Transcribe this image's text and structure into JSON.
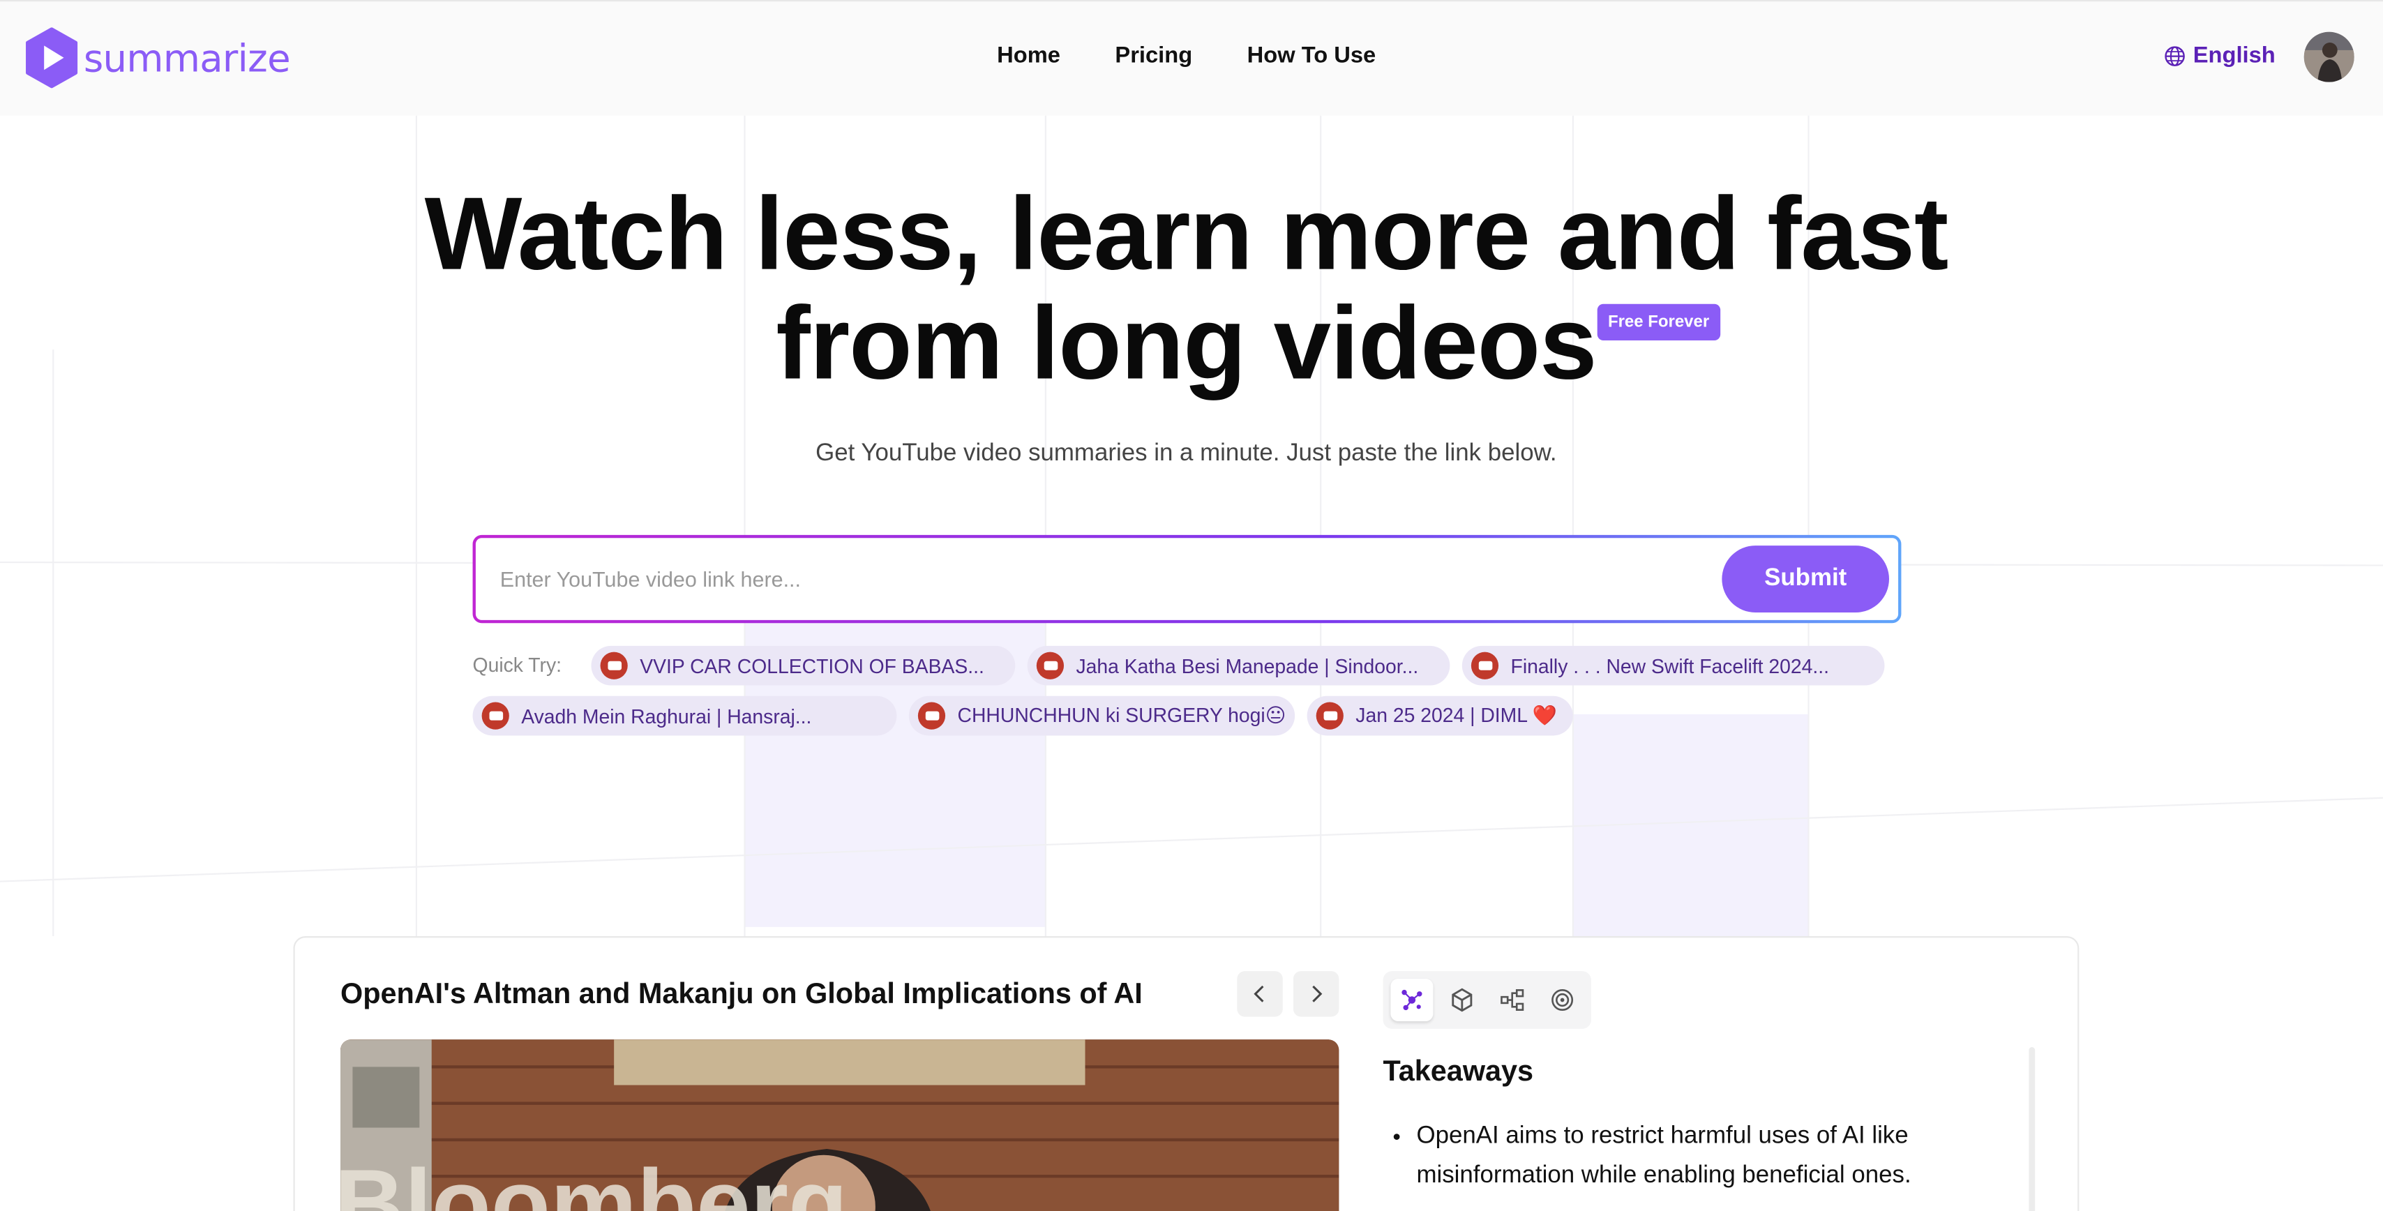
{
  "header": {
    "logo_text": "summarize",
    "nav": [
      {
        "label": "Home"
      },
      {
        "label": "Pricing"
      },
      {
        "label": "How To Use"
      }
    ],
    "language": "English"
  },
  "hero": {
    "title_line1": "Watch less, learn more and fast",
    "title_line2": "from long videos",
    "badge": "Free Forever",
    "subtitle": "Get YouTube video summaries in a minute. Just paste the link below."
  },
  "search": {
    "placeholder": "Enter YouTube video link here...",
    "value": "",
    "submit_label": "Submit"
  },
  "quick_try": {
    "label": "Quick Try:",
    "items": [
      {
        "label": "VVIP CAR COLLECTION OF BABAS..."
      },
      {
        "label": "Jaha Katha Besi Manepade | Sindoor..."
      },
      {
        "label": "Finally . . . New Swift Facelift 2024..."
      },
      {
        "label": "Avadh Mein Raghurai | Hansraj..."
      },
      {
        "label": "CHHUNCHHUN ki SURGERY hogi😐"
      },
      {
        "label": "Jan 25 2024 | DIML ❤️"
      }
    ]
  },
  "demo": {
    "video_title": "OpenAI's Altman and Makanju on Global Implications of AI",
    "video_overlay_text": "Bloomberg",
    "tabs": [
      "takeaways-icon",
      "chapters-icon",
      "mindmap-icon",
      "target-icon"
    ],
    "takeaways_title": "Takeaways",
    "takeaways": [
      "OpenAI aims to restrict harmful uses of AI like misinformation while enabling beneficial ones."
    ]
  },
  "colors": {
    "brand": "#8b5cf6",
    "brand_dark": "#5b21b6",
    "chip_bg": "#ebe7f6"
  }
}
